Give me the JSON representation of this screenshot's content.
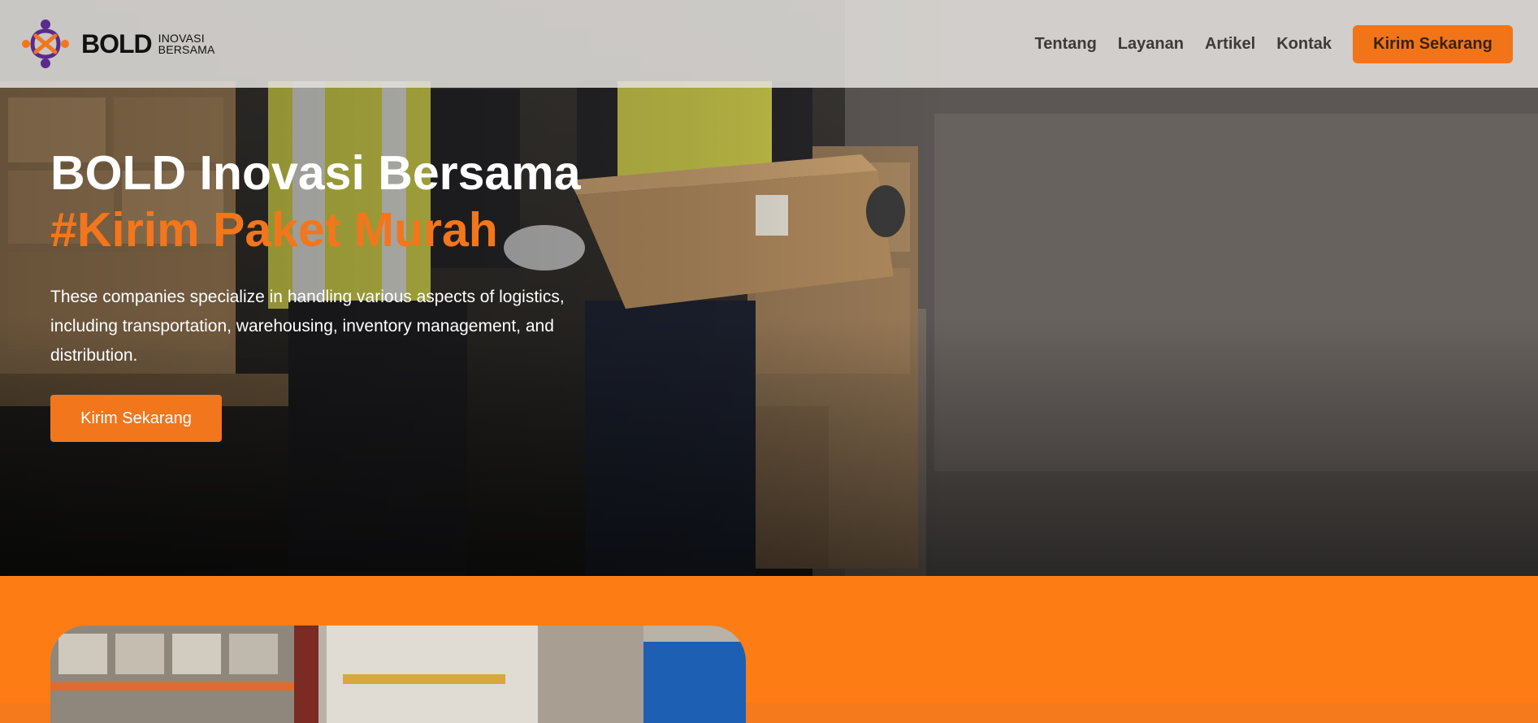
{
  "brand": {
    "name": "BOLD",
    "sub_line1": "INOVASI",
    "sub_line2": "BERSAMA",
    "logo_icon": "interlocking-hearts-logo-icon",
    "colors": {
      "purple": "#5a2a8c",
      "orange": "#f2761c"
    }
  },
  "nav": {
    "links": [
      {
        "label": "Tentang"
      },
      {
        "label": "Layanan"
      },
      {
        "label": "Artikel"
      },
      {
        "label": "Kontak"
      }
    ],
    "cta_label": "Kirim Sekarang"
  },
  "hero": {
    "title": "BOLD Inovasi Bersama",
    "tagline": "#Kirim Paket Murah",
    "description": "These companies specialize in handling various aspects of logistics, including transportation, warehousing, inventory management, and distribution.",
    "button_label": "Kirim Sekarang",
    "background": "warehouse-workers-carrying-box-photo"
  },
  "section2": {
    "image": "warehouse-shelves-photo",
    "background_color": "#fd7d14"
  },
  "colors": {
    "accent": "#f2761c",
    "text_dark": "#3b3b3b",
    "text_light": "#ffffff"
  }
}
